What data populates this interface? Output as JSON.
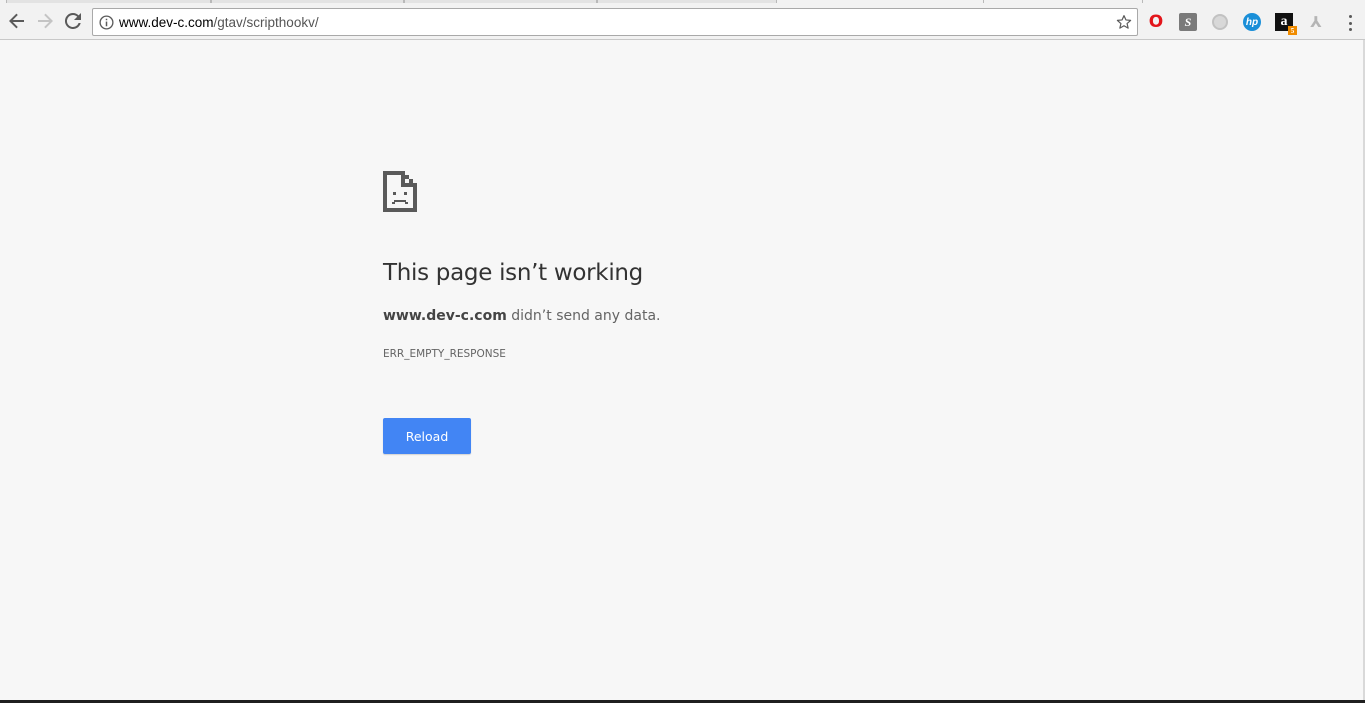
{
  "browser": {
    "url_host": "www.dev-c.com",
    "url_path": "/gtav/scripthookv/",
    "extensions": [
      "opera-icon",
      "sprite-icon",
      "grey-circle-icon",
      "hp-icon",
      "amazon-icon",
      "pdf-icon"
    ],
    "amazon_badge": "5"
  },
  "error_page": {
    "title": "This page isn’t working",
    "host": "www.dev-c.com",
    "detail_suffix": " didn’t send any data.",
    "code": "ERR_EMPTY_RESPONSE",
    "reload_label": "Reload"
  },
  "colors": {
    "accent": "#4285f4",
    "background": "#f7f7f7"
  }
}
